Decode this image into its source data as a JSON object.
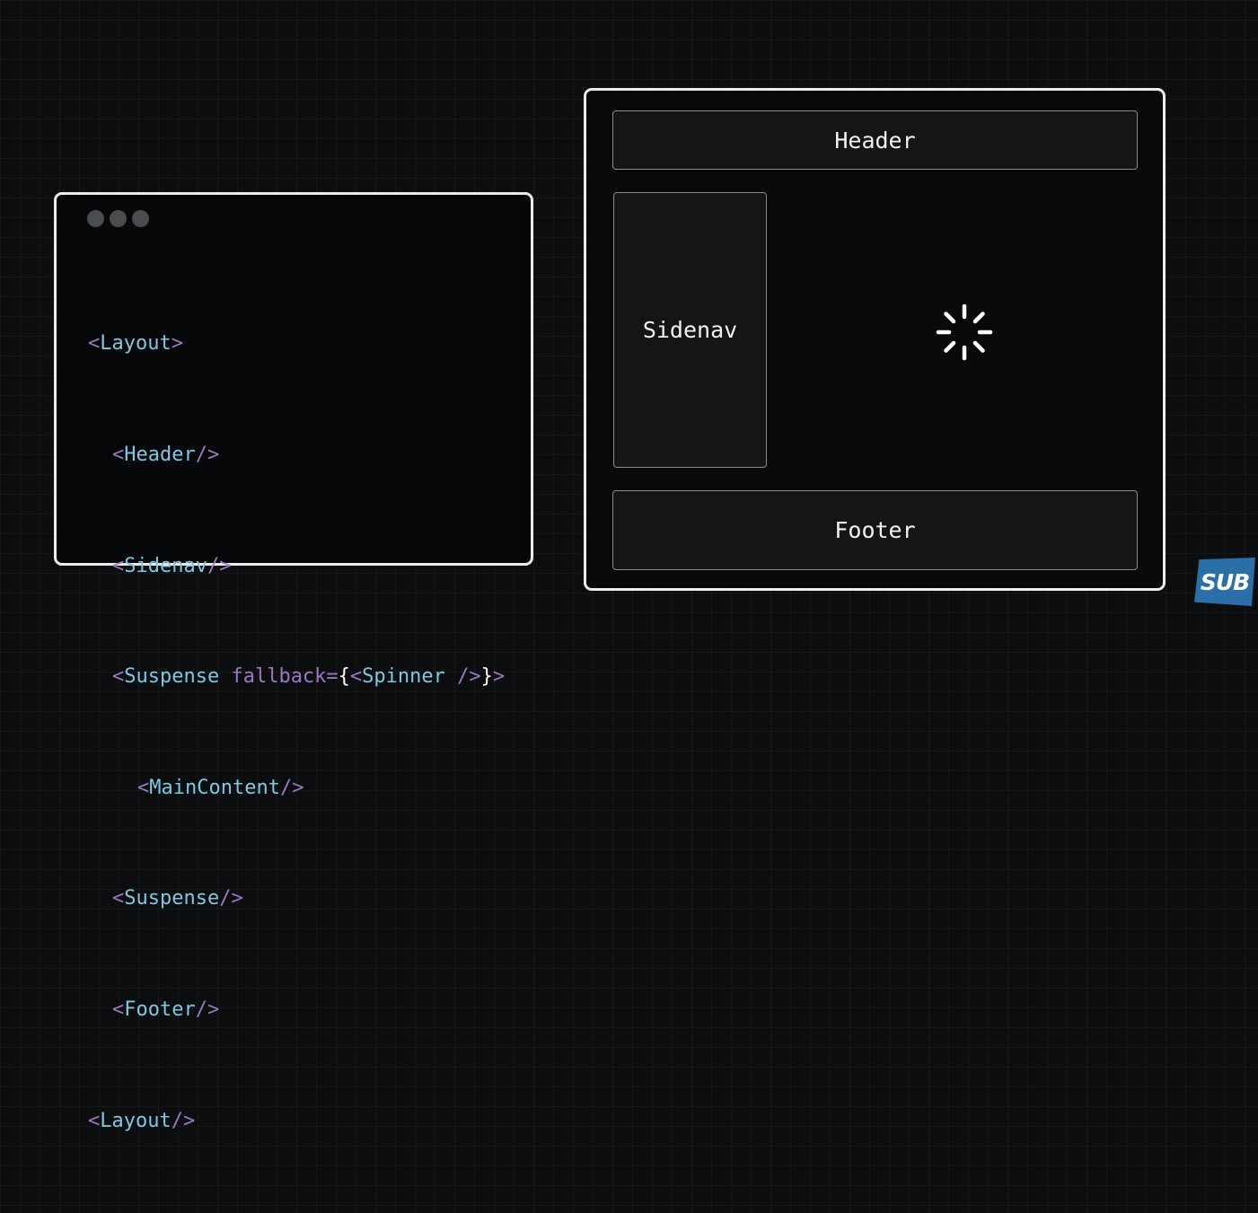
{
  "code_window": {
    "lines": [
      {
        "open": "<",
        "name": "Layout",
        "close": ">"
      },
      {
        "open": "<",
        "name": "Header",
        "close": "/>"
      },
      {
        "open": "<",
        "name": "Sidenav",
        "close": "/>"
      },
      {
        "open": "<",
        "name": "Suspense",
        "attr": " fallback=",
        "brace_open": "{",
        "inner_open": "<",
        "inner_name": "Spinner",
        "inner_close": " />",
        "brace_close": "}",
        "close": ">"
      },
      {
        "open": "<",
        "name": "MainContent",
        "close": "/>"
      },
      {
        "open": "<",
        "name": "Suspense",
        "close": "/>"
      },
      {
        "open": "<",
        "name": "Footer",
        "close": "/>"
      },
      {
        "open": "<",
        "name": "Layout",
        "close": "/>"
      }
    ]
  },
  "layout_diagram": {
    "header_label": "Header",
    "sidenav_label": "Sidenav",
    "footer_label": "Footer",
    "main_state": "loading-spinner"
  },
  "watermark": {
    "text": "SUB",
    "color": "#2a6fa8"
  },
  "colors": {
    "background": "#0b0d0f",
    "tag_name": "#7ec8e3",
    "bracket": "#9b79c2",
    "border": "#ececec"
  }
}
